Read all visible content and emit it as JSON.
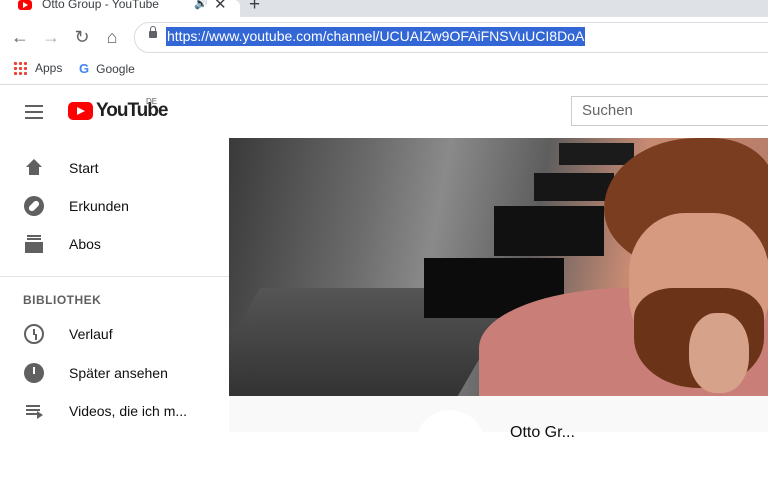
{
  "browser": {
    "tab_title": "Otto Group - YouTube",
    "tab_audio_icon": "speaker-icon",
    "tab_close": "✕",
    "new_tab": "+",
    "back": "←",
    "forward": "→",
    "reload": "↻",
    "home": "⌂",
    "url": "https://www.youtube.com/channel/UCUAIZw9OFAiFNSVuUCI8DoA",
    "bookmarks": [
      {
        "label": "Apps",
        "icon": "apps-grid-icon"
      },
      {
        "label": "Google",
        "icon": "google-g-icon"
      }
    ]
  },
  "youtube": {
    "logo_text": "YouTube",
    "country_code": "DE",
    "search_placeholder": "Suchen",
    "sidebar": {
      "items": [
        {
          "label": "Start",
          "icon": "home-icon"
        },
        {
          "label": "Erkunden",
          "icon": "compass-icon"
        },
        {
          "label": "Abos",
          "icon": "subscriptions-icon"
        }
      ],
      "library_title": "BIBLIOTHEK",
      "library_items": [
        {
          "label": "Verlauf",
          "icon": "history-icon"
        },
        {
          "label": "Später ansehen",
          "icon": "watch-later-icon"
        },
        {
          "label": "Videos, die ich m...",
          "icon": "playlist-icon"
        }
      ]
    },
    "channel_name": "Otto Gr..."
  },
  "colors": {
    "yt_red": "#ff0000",
    "url_highlight": "#3367d6",
    "icon_gray": "#606060"
  }
}
